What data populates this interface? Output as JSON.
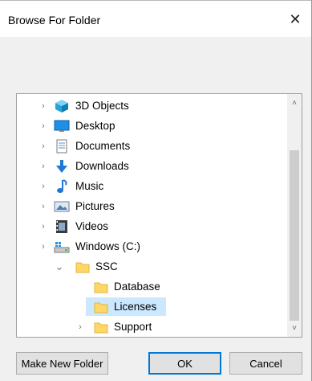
{
  "dialog": {
    "title": "Browse For Folder",
    "close_label": "✕"
  },
  "tree": {
    "items": [
      {
        "label": "3D Objects",
        "icon": "3d-objects-icon",
        "expander": "›"
      },
      {
        "label": "Desktop",
        "icon": "desktop-icon",
        "expander": "›"
      },
      {
        "label": "Documents",
        "icon": "documents-icon",
        "expander": "›"
      },
      {
        "label": "Downloads",
        "icon": "downloads-icon",
        "expander": "›"
      },
      {
        "label": "Music",
        "icon": "music-icon",
        "expander": "›"
      },
      {
        "label": "Pictures",
        "icon": "pictures-icon",
        "expander": "›"
      },
      {
        "label": "Videos",
        "icon": "videos-icon",
        "expander": "›"
      },
      {
        "label": "Windows (C:)",
        "icon": "drive-icon",
        "expander": "›"
      },
      {
        "label": "SSC",
        "icon": "folder-icon",
        "expander": "⌄"
      },
      {
        "label": "Database",
        "icon": "folder-icon",
        "expander": ""
      },
      {
        "label": "Licenses",
        "icon": "folder-icon",
        "expander": "",
        "selected": true
      },
      {
        "label": "Support",
        "icon": "folder-icon",
        "expander": "›"
      }
    ]
  },
  "scrollbar": {
    "up": "˄",
    "down": "˅"
  },
  "buttons": {
    "make_new_folder": "Make New Folder",
    "ok": "OK",
    "cancel": "Cancel"
  },
  "colors": {
    "selection": "#cce8ff",
    "primary_border": "#0078d7",
    "folder": "#ffd766"
  }
}
